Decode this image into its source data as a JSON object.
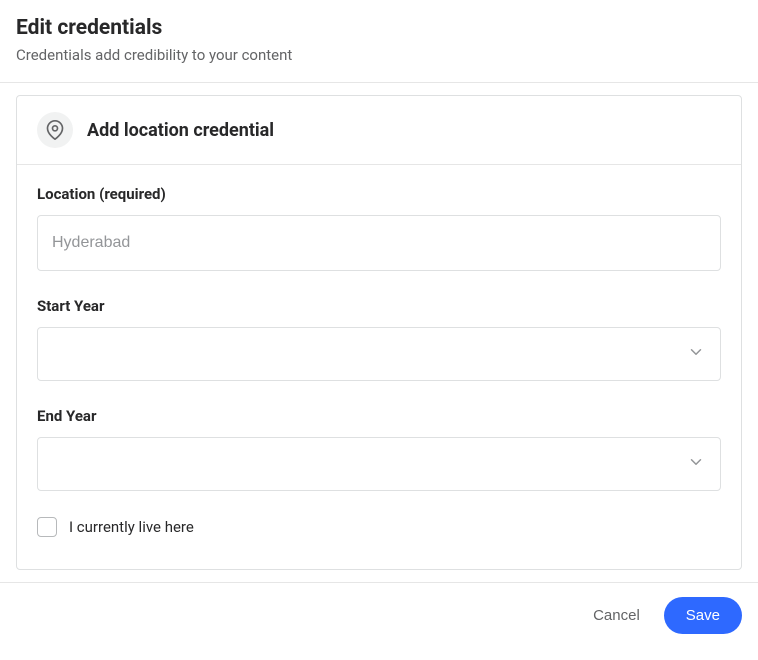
{
  "header": {
    "title": "Edit credentials",
    "subtitle": "Credentials add credibility to your content"
  },
  "panel": {
    "title": "Add location credential"
  },
  "form": {
    "location_label": "Location (required)",
    "location_placeholder": "Hyderabad",
    "location_value": "",
    "start_year_label": "Start Year",
    "start_year_value": "",
    "end_year_label": "End Year",
    "end_year_value": "",
    "currently_live_label": "I currently live here"
  },
  "footer": {
    "cancel": "Cancel",
    "save": "Save"
  }
}
